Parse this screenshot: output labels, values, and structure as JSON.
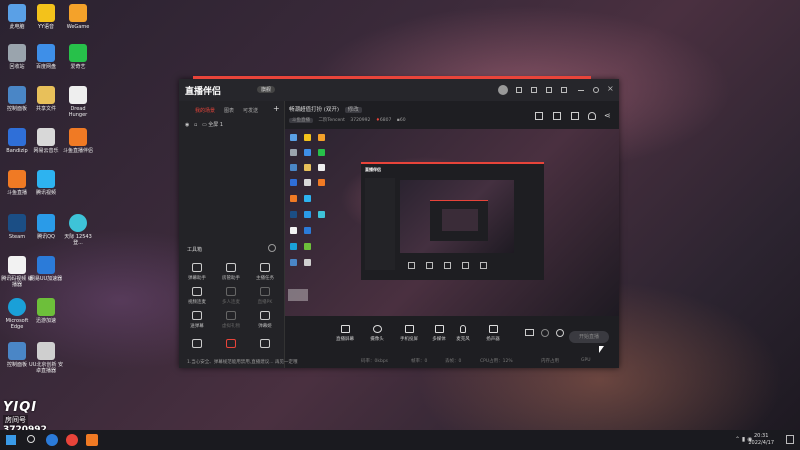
{
  "desktop": {
    "icons": [
      "此电脑",
      "YY语音",
      "WeGame",
      "回收站",
      "百度网盘",
      "爱奇艺",
      "控制面板",
      "共享文件",
      "Dread Hunger",
      "Bandizip",
      "网易云音乐",
      "斗鱼直播伴侣",
      "斗鱼直播",
      "腾讯视频",
      "Steam",
      "腾讯QQ",
      "天际 12543 登...",
      "腾讯码视频 编播器",
      "网易UU加速器",
      "Microsoft Edge",
      "迅游加速",
      "控制面板",
      "UU北京创新 安卓直播器"
    ],
    "colors": {
      "accent": "#e8443a",
      "window_bg": "#1e1e22"
    }
  },
  "app": {
    "logo": "直播伴侣",
    "version_badge": "旗舰",
    "left_tabs": [
      "我的场景",
      "图表",
      "可发送"
    ],
    "scene_label": "全屏 1",
    "tools_title": "工具箱",
    "tools": [
      {
        "label": "弹幕助手",
        "enabled": true
      },
      {
        "label": "房管助手",
        "enabled": true
      },
      {
        "label": "主播任务",
        "enabled": true
      },
      {
        "label": "视频连麦",
        "enabled": true
      },
      {
        "label": "多人连麦",
        "enabled": false
      },
      {
        "label": "直播PK",
        "enabled": false
      },
      {
        "label": "送弹幕",
        "enabled": true
      },
      {
        "label": "虚拟礼物",
        "enabled": false
      },
      {
        "label": "弹幕姬",
        "enabled": true
      }
    ],
    "notice": "1.当心安全、弹幕规范能用禁用,直播建议... 再见一定哦",
    "room_title": "畅潮超值打扮 (双开)",
    "room_tag": "修改",
    "room_info": {
      "category": "斗鱼直播",
      "owner": "二阶Tencent",
      "room_id": "3720992",
      "heat": "6807",
      "viewers": "60"
    },
    "bottom_buttons": [
      "直播屏幕",
      "摄像头",
      "手机投屏",
      "多媒体",
      "麦克风",
      "扬声器"
    ],
    "golive_label": "开始直播",
    "status_items": [
      "码率：0kbps",
      "帧率：0",
      "丢帧：0",
      "CPU占用：12%",
      "内存占用",
      "GPU"
    ]
  },
  "overlay": {
    "big": "YIQI",
    "label": "房间号",
    "room": "3720992"
  },
  "taskbar": {
    "time": "20:31",
    "date": "2022/4/17"
  }
}
